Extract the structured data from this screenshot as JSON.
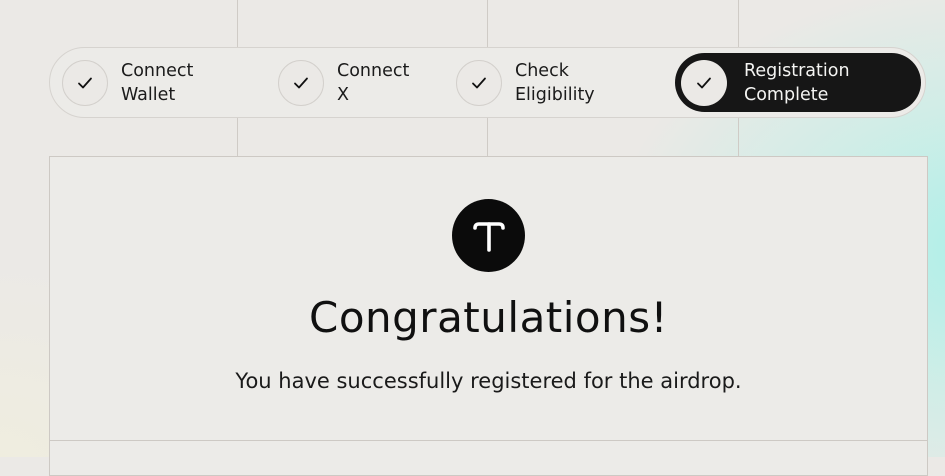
{
  "stepper": {
    "steps": [
      {
        "label": "Connect\nWallet",
        "status": "complete",
        "icon": "check-icon"
      },
      {
        "label": "Connect\nX",
        "status": "complete",
        "icon": "check-icon"
      },
      {
        "label": "Check\nEligibility",
        "status": "complete",
        "icon": "check-icon"
      },
      {
        "label": "Registration\nComplete",
        "status": "active",
        "icon": "check-icon"
      }
    ]
  },
  "card": {
    "logo_icon": "t-logo-icon",
    "heading": "Congratulations!",
    "message": "You have successfully registered for the airdrop."
  },
  "colors": {
    "active_step_bg": "#161616",
    "background": "#ebe9e6",
    "accent_gradient": "#a8f0e8"
  }
}
